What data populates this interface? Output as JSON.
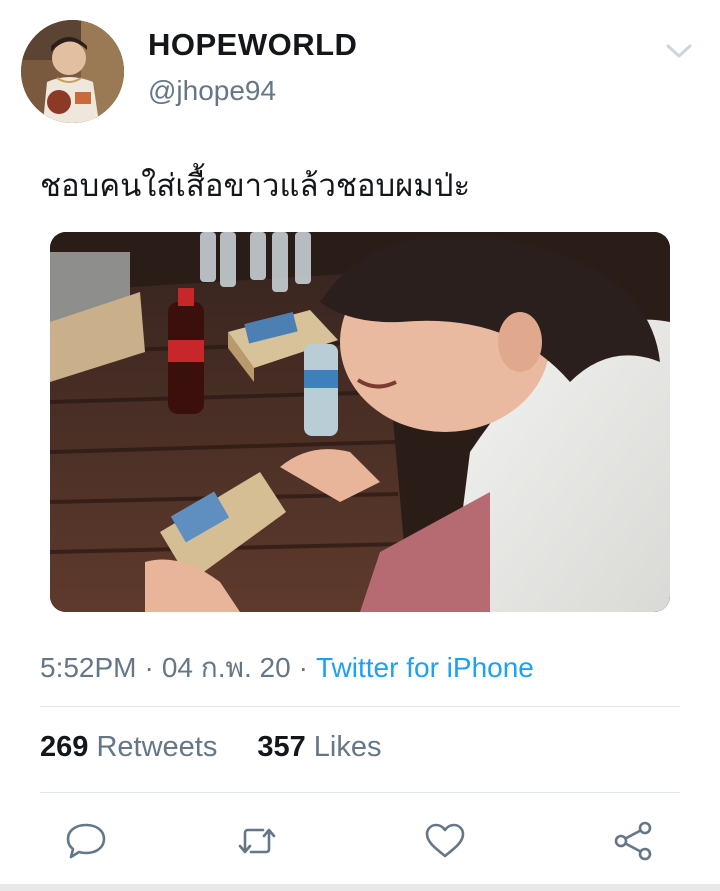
{
  "tweet": {
    "display_name": "HOPEWORLD",
    "handle": "@jhope94",
    "text": "ชอบคนใส่เสื้อขาวแล้วชอบผมป่ะ",
    "time": "5:52PM",
    "date": "04 ก.พ. 20",
    "source": "Twitter for iPhone",
    "separator": "·"
  },
  "stats": {
    "retweets_count": "269",
    "retweets_label": "Retweets",
    "likes_count": "357",
    "likes_label": "Likes"
  },
  "actions": {
    "reply_icon": "speech-bubble-icon",
    "retweet_icon": "retweet-arrows-icon",
    "like_icon": "heart-icon",
    "share_icon": "share-nodes-icon"
  },
  "colors": {
    "text": "#14171a",
    "secondary": "#657786",
    "link": "#1da1f2",
    "icon": "#657786",
    "divider": "#e1e8ed"
  }
}
